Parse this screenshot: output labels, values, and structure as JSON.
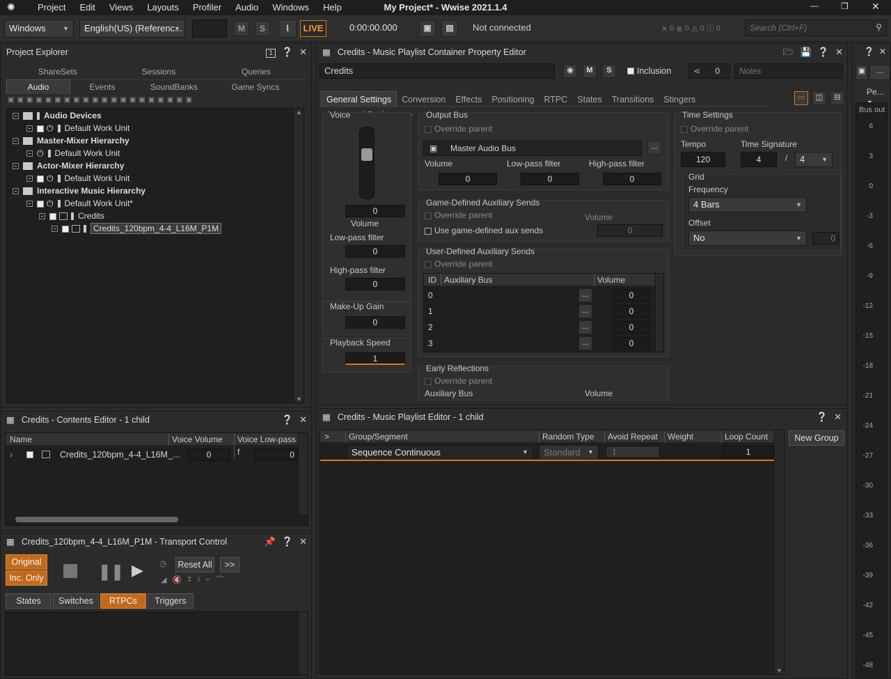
{
  "app": {
    "title": "My Project* - Wwise 2021.1.4",
    "menu": [
      "Project",
      "Edit",
      "Views",
      "Layouts",
      "Profiler",
      "Audio",
      "Windows",
      "Help"
    ]
  },
  "toolbar": {
    "layout": "Windows",
    "language": "English(US) (Referenc...",
    "m": "M",
    "s": "S",
    "live": "LIVE",
    "time": "0:00:00.000",
    "status": "Not connected",
    "c1": "0",
    "c2": "0",
    "c3": "0",
    "c4": "0",
    "search_placeholder": "Search (Ctrl+F)"
  },
  "explorer": {
    "title": "Project Explorer",
    "badge": "1",
    "tabs_top": [
      "ShareSets",
      "Sessions",
      "Queries"
    ],
    "tabs_bottom": [
      "Audio",
      "Events",
      "SoundBanks",
      "Game Syncs"
    ],
    "tree": [
      "Audio Devices",
      "Default Work Unit",
      "Master-Mixer Hierarchy",
      "Default Work Unit",
      "Actor-Mixer Hierarchy",
      "Default Work Unit",
      "Interactive Music Hierarchy",
      "Default Work Unit*",
      "Credits",
      "Credits_120bpm_4-4_L16M_P1M"
    ]
  },
  "contents": {
    "title": "Credits - Contents Editor - 1 child",
    "cols": [
      "Name",
      "Voice Volume",
      "Voice Low-pass f"
    ],
    "row": {
      "name": "Credits_120bpm_4-4_L16M_...",
      "vol": "0",
      "lpf": "0"
    }
  },
  "transport": {
    "title": "Credits_120bpm_4-4_L16M_P1M - Transport Control",
    "original": "Original",
    "inc": "Inc. Only",
    "reset": "Reset All",
    "more": ">>",
    "tabs": [
      "States",
      "Switches",
      "RTPCs",
      "Triggers"
    ]
  },
  "property": {
    "title": "Credits - Music Playlist Container Property Editor",
    "name": "Credits",
    "m": "M",
    "s": "S",
    "inclusion": "Inclusion",
    "share_count": "0",
    "notes_placeholder": "Notes",
    "tabs": [
      "General Settings",
      "Conversion",
      "Effects",
      "Positioning",
      "RTPC",
      "States",
      "Transitions",
      "Stingers",
      "Advanced Settings",
      "+"
    ],
    "voice": {
      "title": "Voice",
      "volume_val": "0",
      "volume_lbl": "Volume",
      "lpf_lbl": "Low-pass filter",
      "lpf_val": "0",
      "hpf_lbl": "High-pass filter",
      "hpf_val": "0",
      "makeup_lbl": "Make-Up Gain",
      "makeup_val": "0",
      "speed_lbl": "Playback Speed",
      "speed_val": "1"
    },
    "output": {
      "title": "Output Bus",
      "override": "Override parent",
      "bus": "Master Audio Bus",
      "more": "...",
      "vol_lbl": "Volume",
      "vol": "0",
      "lpf_lbl": "Low-pass filter",
      "lpf": "0",
      "hpf_lbl": "High-pass filter",
      "hpf": "0"
    },
    "gdaux": {
      "title": "Game-Defined Auxiliary Sends",
      "override": "Override parent",
      "use": "Use game-defined aux sends",
      "vol_lbl": "Volume",
      "vol": "0"
    },
    "udaux": {
      "title": "User-Defined Auxiliary Sends",
      "override": "Override parent",
      "cols": [
        "ID",
        "Auxiliary Bus",
        "Volume"
      ],
      "rows": [
        {
          "id": "0",
          "v": "0"
        },
        {
          "id": "1",
          "v": "0"
        },
        {
          "id": "2",
          "v": "0"
        },
        {
          "id": "3",
          "v": "0"
        }
      ],
      "more": "..."
    },
    "early": {
      "title": "Early Reflections",
      "override": "Override parent",
      "aux": "Auxiliary Bus",
      "vol": "Volume"
    },
    "time": {
      "title": "Time Settings",
      "override": "Override parent",
      "tempo_lbl": "Tempo",
      "tempo": "120",
      "sig_lbl": "Time Signature",
      "sig_num": "4",
      "slash": "/",
      "sig_den": "4",
      "grid": "Grid",
      "freq_lbl": "Frequency",
      "freq": "4 Bars",
      "offset_lbl": "Offset",
      "offset": "No",
      "offset_val": "0"
    }
  },
  "playlist": {
    "title": "Credits - Music Playlist Editor - 1 child",
    "cols": [
      ">",
      "Group/Segment",
      "Random Type",
      "Avoid Repeat",
      "Weight",
      "Loop Count"
    ],
    "row": {
      "group": "Sequence Continuous",
      "random": "Standard",
      "avoid": "1",
      "loop": "1"
    },
    "new_group": "New Group"
  },
  "meter": {
    "dropdown": "Pe...",
    "label": "Bus out",
    "ticks": [
      "6",
      "3",
      "0",
      "-3",
      "-6",
      "-9",
      "-12",
      "-15",
      "-18",
      "-21",
      "-24",
      "-27",
      "-30",
      "-33",
      "-36",
      "-39",
      "-42",
      "-45",
      "-48"
    ]
  }
}
